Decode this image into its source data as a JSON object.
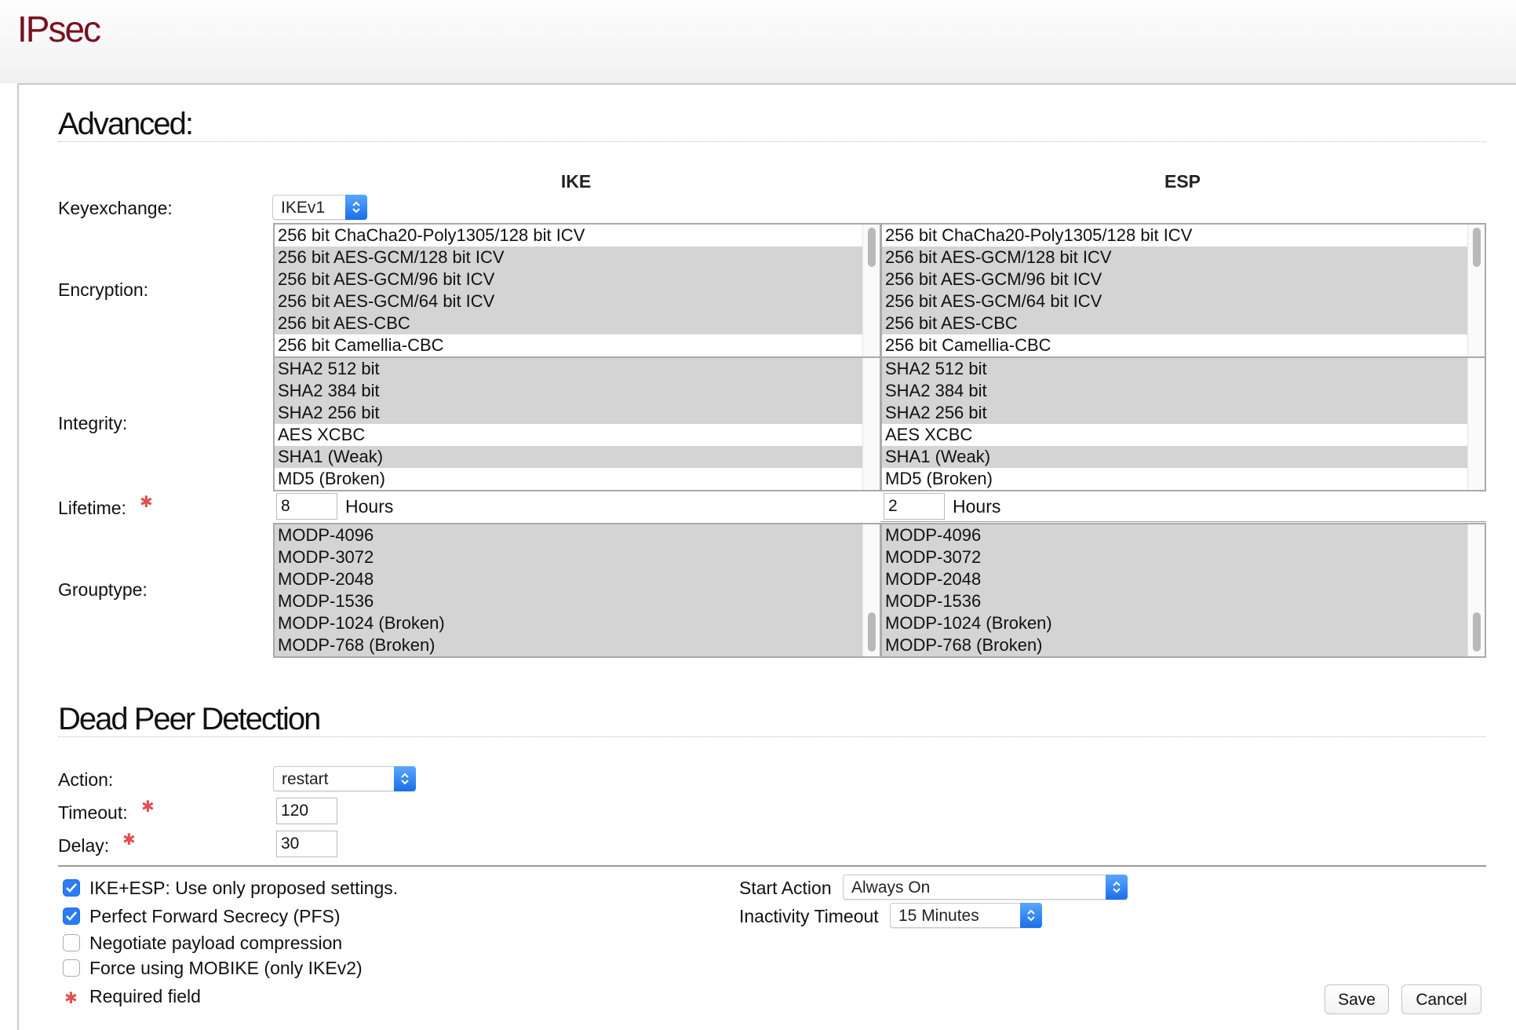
{
  "page": {
    "title": "IPsec"
  },
  "advanced": {
    "title": "Advanced:",
    "col_ike": "IKE",
    "col_esp": "ESP",
    "keyexchange": {
      "label": "Keyexchange:",
      "value": "IKEv1"
    },
    "encryption": {
      "label": "Encryption:",
      "ike": [
        {
          "text": "256 bit ChaCha20-Poly1305/128 bit ICV",
          "selected": false
        },
        {
          "text": "256 bit AES-GCM/128 bit ICV",
          "selected": true
        },
        {
          "text": "256 bit AES-GCM/96 bit ICV",
          "selected": true
        },
        {
          "text": "256 bit AES-GCM/64 bit ICV",
          "selected": true
        },
        {
          "text": "256 bit AES-CBC",
          "selected": true
        },
        {
          "text": "256 bit Camellia-CBC",
          "selected": false
        }
      ],
      "esp": [
        {
          "text": "256 bit ChaCha20-Poly1305/128 bit ICV",
          "selected": false
        },
        {
          "text": "256 bit AES-GCM/128 bit ICV",
          "selected": true
        },
        {
          "text": "256 bit AES-GCM/96 bit ICV",
          "selected": true
        },
        {
          "text": "256 bit AES-GCM/64 bit ICV",
          "selected": true
        },
        {
          "text": "256 bit AES-CBC",
          "selected": true
        },
        {
          "text": "256 bit Camellia-CBC",
          "selected": false
        }
      ]
    },
    "integrity": {
      "label": "Integrity:",
      "ike": [
        {
          "text": "SHA2 512 bit",
          "selected": true
        },
        {
          "text": "SHA2 384 bit",
          "selected": true
        },
        {
          "text": "SHA2 256 bit",
          "selected": true
        },
        {
          "text": "AES XCBC",
          "selected": false
        },
        {
          "text": "SHA1 (Weak)",
          "selected": true
        },
        {
          "text": "MD5 (Broken)",
          "selected": false
        }
      ],
      "esp": [
        {
          "text": "SHA2 512 bit",
          "selected": true
        },
        {
          "text": "SHA2 384 bit",
          "selected": true
        },
        {
          "text": "SHA2 256 bit",
          "selected": true
        },
        {
          "text": "AES XCBC",
          "selected": false
        },
        {
          "text": "SHA1 (Weak)",
          "selected": true
        },
        {
          "text": "MD5 (Broken)",
          "selected": false
        }
      ]
    },
    "lifetime": {
      "label": "Lifetime:",
      "ike_value": "8",
      "esp_value": "2",
      "unit": "Hours"
    },
    "grouptype": {
      "label": "Grouptype:",
      "ike": [
        {
          "text": "MODP-4096",
          "selected": true
        },
        {
          "text": "MODP-3072",
          "selected": true
        },
        {
          "text": "MODP-2048",
          "selected": true
        },
        {
          "text": "MODP-1536",
          "selected": true
        },
        {
          "text": "MODP-1024 (Broken)",
          "selected": true
        },
        {
          "text": "MODP-768 (Broken)",
          "selected": true
        }
      ],
      "esp": [
        {
          "text": "MODP-4096",
          "selected": true
        },
        {
          "text": "MODP-3072",
          "selected": true
        },
        {
          "text": "MODP-2048",
          "selected": true
        },
        {
          "text": "MODP-1536",
          "selected": true
        },
        {
          "text": "MODP-1024 (Broken)",
          "selected": true
        },
        {
          "text": "MODP-768 (Broken)",
          "selected": true
        }
      ]
    }
  },
  "dpd": {
    "title": "Dead Peer Detection",
    "action_label": "Action:",
    "action_value": "restart",
    "timeout_label": "Timeout:",
    "timeout_value": "120",
    "delay_label": "Delay:",
    "delay_value": "30"
  },
  "options": {
    "checkboxes": [
      {
        "label": "IKE+ESP: Use only proposed settings.",
        "checked": true
      },
      {
        "label": "Perfect Forward Secrecy (PFS)",
        "checked": true
      },
      {
        "label": "Negotiate payload compression",
        "checked": false
      },
      {
        "label": "Force using MOBIKE (only IKEv2)",
        "checked": false
      }
    ],
    "required_note": "Required field",
    "start_action_label": "Start Action",
    "start_action_value": "Always On",
    "inactivity_label": "Inactivity Timeout",
    "inactivity_value": "15 Minutes"
  },
  "buttons": {
    "save": "Save",
    "cancel": "Cancel"
  },
  "colors": {
    "title": "#7a1020",
    "accent": "#2a7cf5",
    "required": "#e05050",
    "selection": "#d4d4d4"
  }
}
